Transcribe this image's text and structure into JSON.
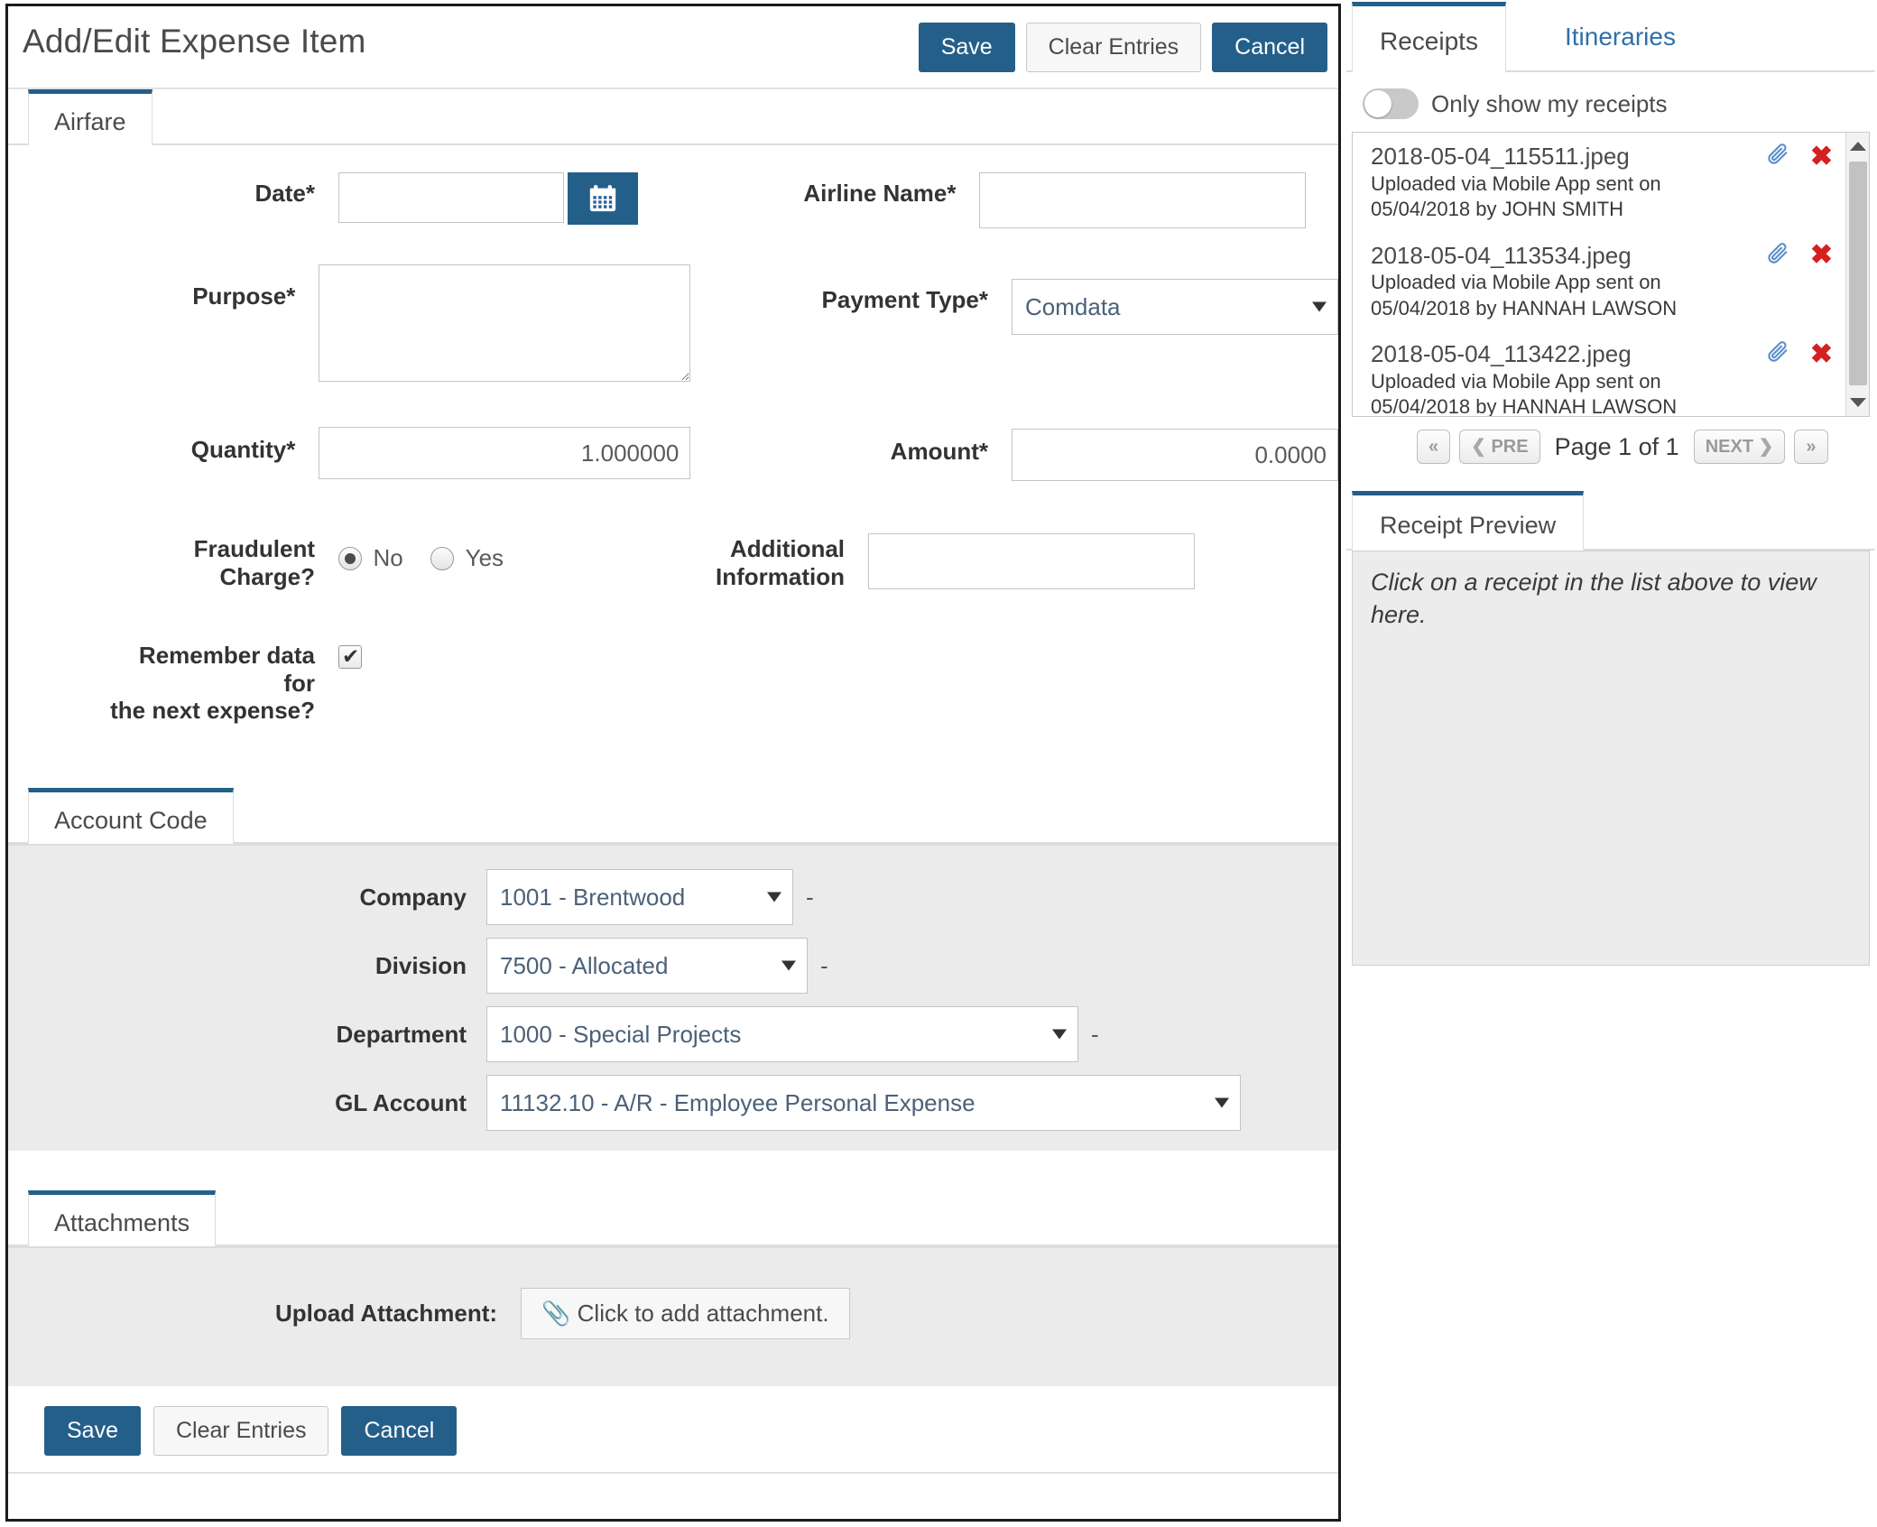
{
  "form": {
    "title": "Add/Edit Expense Item",
    "header_buttons": [
      {
        "label": "Save",
        "style": "primary"
      },
      {
        "label": "Clear Entries",
        "style": "secondary"
      },
      {
        "label": "Cancel",
        "style": "primary"
      }
    ],
    "tab": "Airfare",
    "fields": {
      "date": {
        "label": "Date*",
        "value": "",
        "calendar_icon": "calendar-icon"
      },
      "airline_name": {
        "label": "Airline Name*",
        "value": ""
      },
      "purpose": {
        "label": "Purpose*",
        "value": ""
      },
      "payment_type": {
        "label": "Payment Type*",
        "value": "Comdata"
      },
      "quantity": {
        "label": "Quantity*",
        "value": "1.000000"
      },
      "amount": {
        "label": "Amount*",
        "value": "0.0000"
      },
      "fraudulent": {
        "label_line1": "Fraudulent",
        "label_line2": "Charge?",
        "option_no": "No",
        "option_yes": "Yes",
        "selected": "No"
      },
      "additional_info": {
        "label_line1": "Additional",
        "label_line2": "Information",
        "value": ""
      },
      "remember": {
        "label_line1": "Remember data",
        "label_line2": "for",
        "label_line3": "the next expense?",
        "checked": true
      }
    },
    "account_code": {
      "tab": "Account Code",
      "separator": "-",
      "rows": [
        {
          "label": "Company",
          "value": "1001 - Brentwood"
        },
        {
          "label": "Division",
          "value": "7500 - Allocated"
        },
        {
          "label": "Department",
          "value": "1000 - Special Projects"
        },
        {
          "label": "GL Account",
          "value": "11132.10 - A/R - Employee Personal Expense"
        }
      ]
    },
    "attachments": {
      "tab": "Attachments",
      "upload_label": "Upload Attachment:",
      "upload_button": "Click to add attachment."
    },
    "footer_buttons": [
      {
        "label": "Save",
        "style": "primary"
      },
      {
        "label": "Clear Entries",
        "style": "secondary"
      },
      {
        "label": "Cancel",
        "style": "primary"
      }
    ]
  },
  "right": {
    "tabs": [
      {
        "label": "Receipts",
        "active": true
      },
      {
        "label": "Itineraries",
        "active": false
      }
    ],
    "toggle": {
      "label": "Only show my receipts",
      "on": false
    },
    "receipts": [
      {
        "filename": "2018-05-04_115511.jpeg",
        "meta_line1": "Uploaded via Mobile App sent on",
        "meta_line2": "05/04/2018 by JOHN SMITH"
      },
      {
        "filename": "2018-05-04_113534.jpeg",
        "meta_line1": "Uploaded via Mobile App sent on",
        "meta_line2": "05/04/2018 by HANNAH LAWSON"
      },
      {
        "filename": "2018-05-04_113422.jpeg",
        "meta_line1": "Uploaded via Mobile App sent on",
        "meta_line2": "05/04/2018 by HANNAH LAWSON"
      }
    ],
    "pager": {
      "first": "«",
      "prev": "PRE",
      "page_text": "Page 1 of 1",
      "next": "NEXT",
      "last": "»"
    },
    "preview": {
      "tab": "Receipt Preview",
      "placeholder": "Click on a receipt in the list above to view here."
    }
  },
  "colors": {
    "accent": "#245f8a",
    "link": "#2f6fa8",
    "panel_bg": "#ebebeb",
    "delete": "#d32020",
    "clip": "#5b8fc9"
  }
}
